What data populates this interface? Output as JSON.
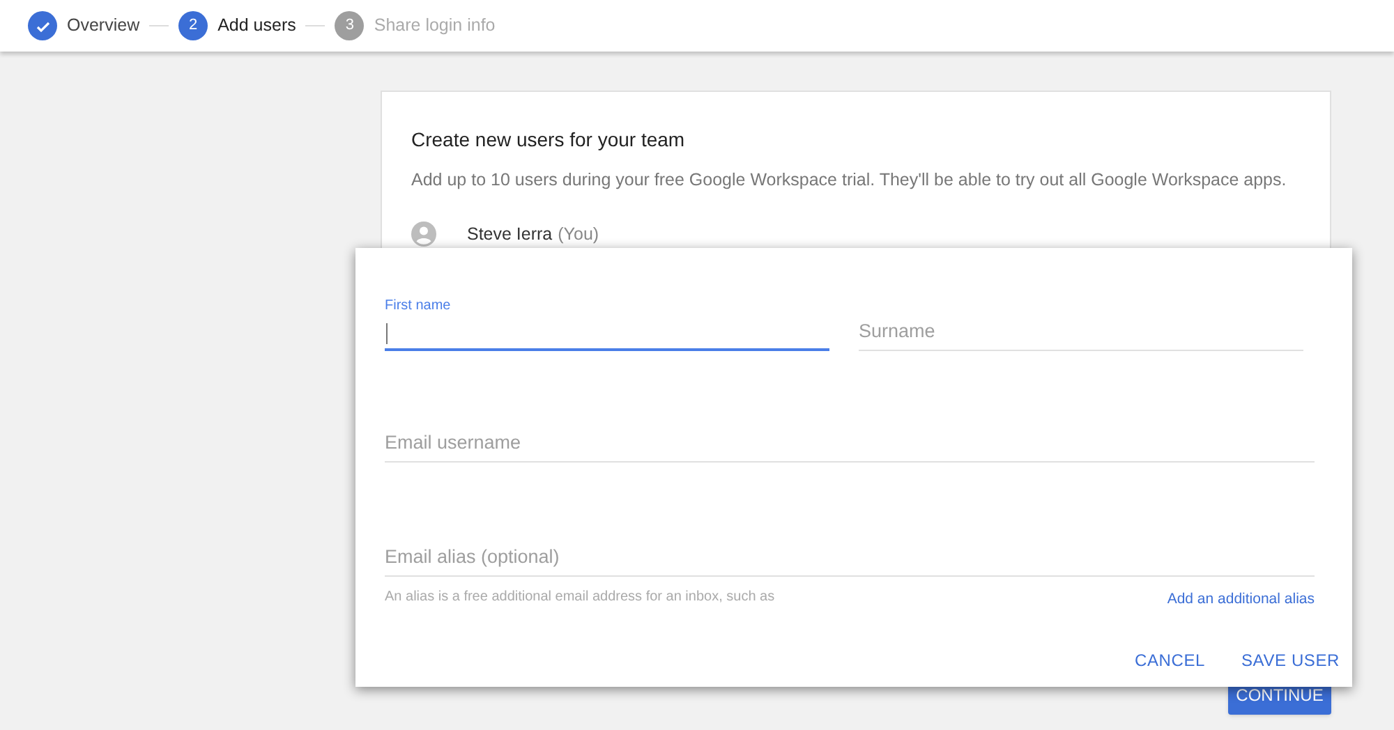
{
  "steps": [
    {
      "label": "Overview",
      "kind": "done"
    },
    {
      "label": "Add users",
      "number": "2",
      "kind": "current"
    },
    {
      "label": "Share login info",
      "number": "3",
      "kind": "upcoming"
    }
  ],
  "card": {
    "title": "Create new users for your team",
    "subtitle": "Add up to 10 users during your free Google Workspace trial. They'll be able to try out all Google Workspace apps.",
    "user_name": "Steve Ierra",
    "user_note": "(You)"
  },
  "dialog": {
    "fields": [
      {
        "label": "First name",
        "focused": true
      },
      {
        "label": "Surname",
        "focused": false
      },
      {
        "label": "Email username",
        "focused": false
      },
      {
        "label": "Email alias (optional)",
        "focused": false
      }
    ],
    "hint": "An alias is a free additional email address for an inbox, such as",
    "link": "Add an additional alias",
    "buttons": [
      "CANCEL",
      "SAVE USER"
    ]
  },
  "continue_button": "CONTINUE"
}
